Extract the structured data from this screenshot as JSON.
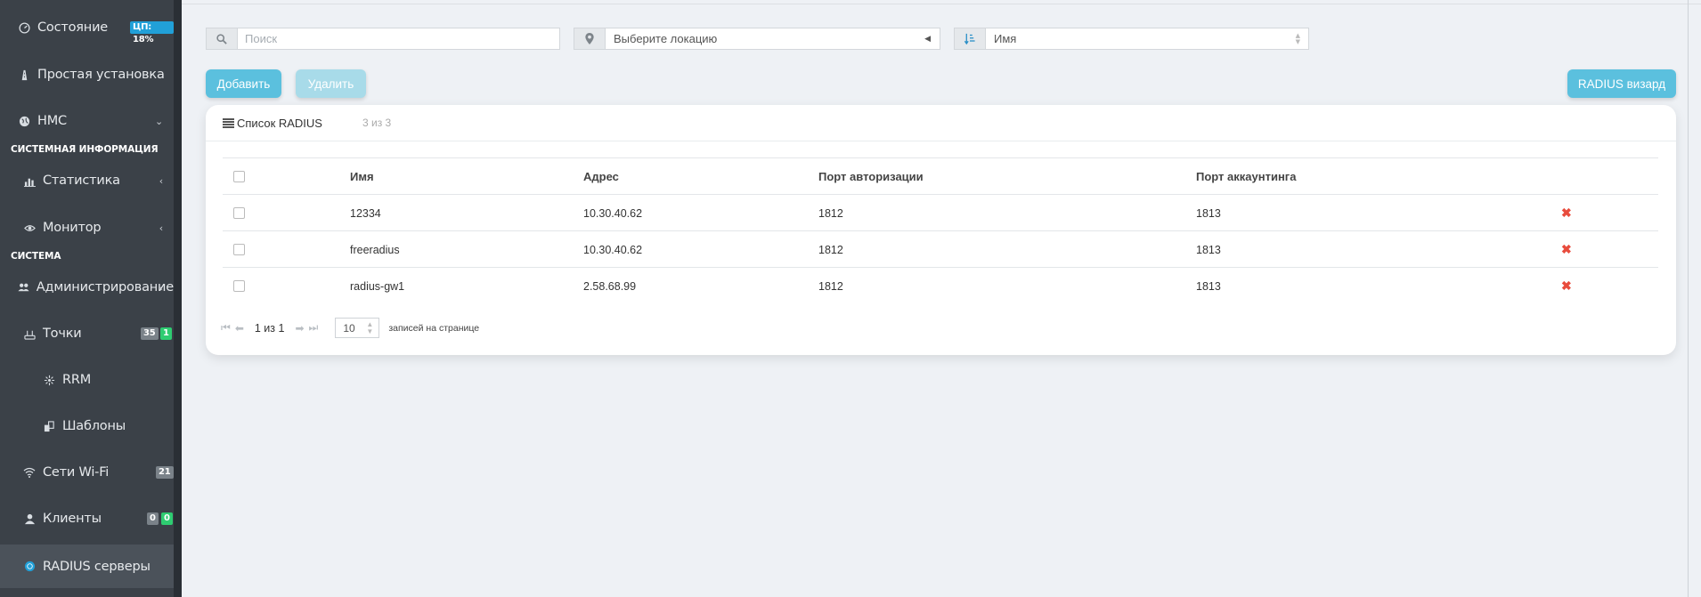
{
  "sidebar": {
    "items": [
      {
        "label": "Состояние",
        "icon": "dashboard-icon",
        "badge": "ЦП: 18%"
      },
      {
        "label": "Простая установка",
        "icon": "road-icon"
      },
      {
        "label": "НМС",
        "icon": "globe-icon",
        "chevron": "⌄"
      },
      {
        "label": "Статистика",
        "icon": "bar-chart-icon",
        "chevron": "‹"
      },
      {
        "label": "Монитор",
        "icon": "eye-icon",
        "chevron": "‹"
      },
      {
        "label": "Администрирование",
        "icon": "users-icon",
        "chevron": "‹"
      },
      {
        "label": "Точки",
        "icon": "router-icon",
        "badge1": "35",
        "badge2": "1"
      },
      {
        "label": "RRM",
        "icon": "rrm-icon"
      },
      {
        "label": "Шаблоны",
        "icon": "templates-icon"
      },
      {
        "label": "Сети Wi-Fi",
        "icon": "wifi-icon",
        "badge1": "21"
      },
      {
        "label": "Клиенты",
        "icon": "user-icon",
        "badge1": "0",
        "badge2": "0"
      },
      {
        "label": "RADIUS серверы",
        "icon": "radius-icon"
      }
    ],
    "sections": {
      "system_info": "СИСТЕМНАЯ ИНФОРМАЦИЯ",
      "system": "СИСТЕМА"
    }
  },
  "filters": {
    "search_placeholder": "Поиск",
    "location_placeholder": "Выберите локацию",
    "sort_value": "Имя"
  },
  "toolbar": {
    "add_label": "Добавить",
    "delete_label": "Удалить",
    "wizard_label": "RADIUS визард"
  },
  "card": {
    "title": "Список RADIUS",
    "count": "3 из 3"
  },
  "table": {
    "headers": [
      "Имя",
      "Адрес",
      "Порт авторизации",
      "Порт аккаунтинга"
    ],
    "rows": [
      [
        "12334",
        "10.30.40.62",
        "1812",
        "1813"
      ],
      [
        "freeradius",
        "10.30.40.62",
        "1812",
        "1813"
      ],
      [
        "radius-gw1",
        "2.58.68.99",
        "1812",
        "1813"
      ]
    ]
  },
  "pager": {
    "page_text": "1 из 1",
    "per_page": "10",
    "per_page_label": "записей на странице"
  },
  "colors": {
    "sidebar": "#3b4148",
    "accent": "#5bc0de",
    "delete": "#e84c3d"
  }
}
